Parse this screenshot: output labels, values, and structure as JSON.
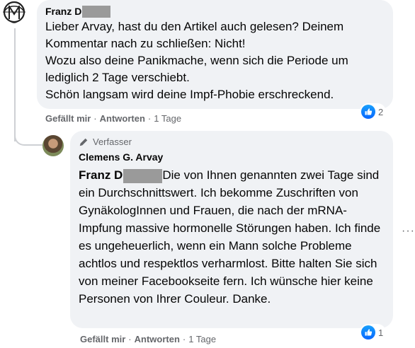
{
  "comment1": {
    "author_name": "Franz D",
    "text": "Lieber Arvay, hast du den Artikel auch gelesen? Deinem\nKommentar nach zu schließen: Nicht!\nWozu also deine Panikmache, wenn sich die Periode um\nlediglich 2 Tage verschiebt.\nSchön langsam wird deine Impf-Phobie erschreckend.",
    "like_label": "Gefällt mir",
    "reply_label": "Antworten",
    "time": "1 Tage",
    "reaction_count": "2",
    "separator": "·"
  },
  "comment2": {
    "badge": "Verfasser",
    "author_name": "Clemens G. Arvay",
    "mention": "Franz D",
    "text": "Die von Ihnen genannten zwei Tage sind ein Durchschnittswert. Ich bekomme Zuschriften von GynäkologInnen und Frauen, die nach der mRNA-Impfung massive hormonelle Störungen haben. Ich finde es ungeheuerlich, wenn ein Mann solche Probleme achtlos und respektlos verharmlost. Bitte halten Sie sich von meiner Facebookseite fern. Ich wünsche hier keine Personen von Ihrer Couleur. Danke.",
    "like_label": "Gefällt mir",
    "reply_label": "Antworten",
    "time": "1 Tage",
    "reaction_count": "1",
    "separator": "·"
  },
  "icons": {
    "page_logo": "ornamental-logo-icon",
    "badge": "pencil-icon",
    "reaction": "like-icon",
    "more": "more-options-icon"
  },
  "more_label": "···",
  "colors": {
    "bubble": "#f0f2f5",
    "secondary_text": "#65676b",
    "like_blue": "#0866ff",
    "redaction": "#9a9a9a"
  }
}
